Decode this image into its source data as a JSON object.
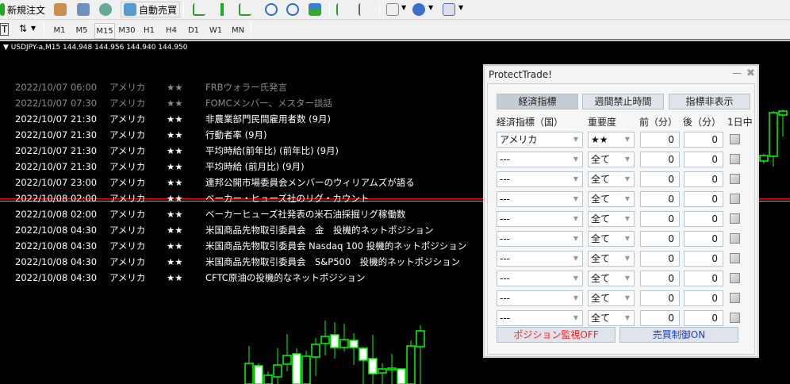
{
  "toolbar": {
    "new_order": "新規注文",
    "auto_trade": "自動売買",
    "timeframes": [
      "M1",
      "M5",
      "M15",
      "M30",
      "H1",
      "H4",
      "D1",
      "W1",
      "MN"
    ],
    "selected_timeframe": "M15"
  },
  "chart": {
    "symbol_info": "USDJPY-a,M15  144.948 144.956 144.940 144.950",
    "price_scale": {
      "top": 145.0
    },
    "candles_left": [
      [
        144.782,
        144.758,
        144.771,
        144.758,
        1
      ],
      [
        144.771,
        144.758,
        144.7695,
        144.758,
        0
      ],
      [
        144.766,
        144.758,
        144.7635,
        144.758,
        1
      ],
      [
        144.7805,
        144.758,
        144.77,
        144.7625,
        1
      ],
      [
        144.7895,
        144.766,
        144.776,
        144.7705,
        1
      ],
      [
        144.7805,
        144.758,
        144.777,
        144.758,
        0
      ],
      [
        144.779,
        144.758,
        144.7755,
        144.758,
        1
      ],
      [
        144.787,
        144.763,
        144.783,
        144.775,
        1
      ],
      [
        144.798,
        144.776,
        144.788,
        144.7835,
        1
      ],
      [
        144.797,
        144.774,
        144.789,
        144.781,
        0
      ],
      [
        144.796,
        144.7785,
        144.786,
        144.781,
        1
      ],
      [
        144.79,
        144.77,
        144.7855,
        144.781,
        0
      ],
      [
        144.7815,
        144.758,
        144.7805,
        144.773,
        0
      ],
      [
        144.789,
        144.758,
        144.774,
        144.7645,
        0
      ],
      [
        144.771,
        144.758,
        144.7675,
        144.765,
        1
      ],
      [
        144.777,
        144.758,
        144.768,
        144.767,
        1
      ],
      [
        144.7675,
        144.758,
        144.7675,
        144.758,
        0
      ],
      [
        144.7855,
        144.758,
        144.782,
        144.758,
        1
      ],
      [
        144.795,
        144.758,
        144.7915,
        144.7815,
        1
      ]
    ],
    "candles_right": [
      [
        144.903,
        144.897,
        144.902,
        144.8985,
        1
      ],
      [
        144.93,
        144.895,
        144.929,
        144.9015,
        1
      ],
      [
        144.931,
        144.914,
        144.93,
        144.9275,
        1
      ]
    ],
    "events": [
      {
        "time": "2022/10/07 06:00",
        "country": "アメリカ",
        "stars": "★★",
        "title": "FRBウォラー氏発言",
        "past": true
      },
      {
        "time": "2022/10/07 07:30",
        "country": "アメリカ",
        "stars": "★★",
        "title": "FOMCメンバー、メスター談話",
        "past": true
      },
      {
        "time": "2022/10/07 21:30",
        "country": "アメリカ",
        "stars": "★★",
        "title": "非農業部門民間雇用者数 (9月)",
        "past": false
      },
      {
        "time": "2022/10/07 21:30",
        "country": "アメリカ",
        "stars": "★★",
        "title": "行動者率 (9月)",
        "past": false
      },
      {
        "time": "2022/10/07 21:30",
        "country": "アメリカ",
        "stars": "★★",
        "title": "平均時給(前年比) (前年比) (9月)",
        "past": false
      },
      {
        "time": "2022/10/07 21:30",
        "country": "アメリカ",
        "stars": "★★",
        "title": "平均時給 (前月比) (9月)",
        "past": false
      },
      {
        "time": "2022/10/07 23:00",
        "country": "アメリカ",
        "stars": "★★",
        "title": "連邦公開市場委員会メンバーのウィリアムズが語る",
        "past": false
      },
      {
        "time": "2022/10/08 02:00",
        "country": "アメリカ",
        "stars": "★★",
        "title": "ベーカー・ヒューズ社のリグ・カウント",
        "past": false
      },
      {
        "time": "2022/10/08 02:00",
        "country": "アメリカ",
        "stars": "★★",
        "title": "ベーカーヒューズ社発表の米石油採掘リグ稼働数",
        "past": false
      },
      {
        "time": "2022/10/08 04:30",
        "country": "アメリカ",
        "stars": "★★",
        "title": "米国商品先物取引委員会　金　投機的ネットポジション",
        "past": false
      },
      {
        "time": "2022/10/08 04:30",
        "country": "アメリカ",
        "stars": "★★",
        "title": "米国商品先物取引委員会 Nasdaq 100 投機的ネットポジション",
        "past": false
      },
      {
        "time": "2022/10/08 04:30",
        "country": "アメリカ",
        "stars": "★★",
        "title": "米国商品先物取引委員会　S&P500　投機的ネットポジション",
        "past": false
      },
      {
        "time": "2022/10/08 04:30",
        "country": "アメリカ",
        "stars": "★★",
        "title": "CFTC原油の投機的なネットポジション",
        "past": false
      }
    ]
  },
  "dialog": {
    "title": "ProtectTrade!",
    "minimize": "—",
    "close": "✖",
    "tabs": [
      "経済指標",
      "週間禁止時間",
      "指標非表示"
    ],
    "headers": [
      "経済指標（国）",
      "重要度",
      "前（分）",
      "後（分）",
      "1日中"
    ],
    "rows": [
      {
        "country": "アメリカ",
        "importance": "★★",
        "before": "0",
        "after": "0"
      },
      {
        "country": "---",
        "importance": "全て",
        "before": "0",
        "after": "0"
      },
      {
        "country": "---",
        "importance": "全て",
        "before": "0",
        "after": "0"
      },
      {
        "country": "---",
        "importance": "全て",
        "before": "0",
        "after": "0"
      },
      {
        "country": "---",
        "importance": "全て",
        "before": "0",
        "after": "0"
      },
      {
        "country": "---",
        "importance": "全て",
        "before": "0",
        "after": "0"
      },
      {
        "country": "---",
        "importance": "全て",
        "before": "0",
        "after": "0"
      },
      {
        "country": "---",
        "importance": "全て",
        "before": "0",
        "after": "0"
      },
      {
        "country": "---",
        "importance": "全て",
        "before": "0",
        "after": "0"
      },
      {
        "country": "---",
        "importance": "全て",
        "before": "0",
        "after": "0"
      }
    ],
    "position_monitor": "ポジション監視OFF",
    "trade_control": "売買制御ON",
    "colors": {
      "off": "#ff2020",
      "on": "#2040d0"
    }
  }
}
